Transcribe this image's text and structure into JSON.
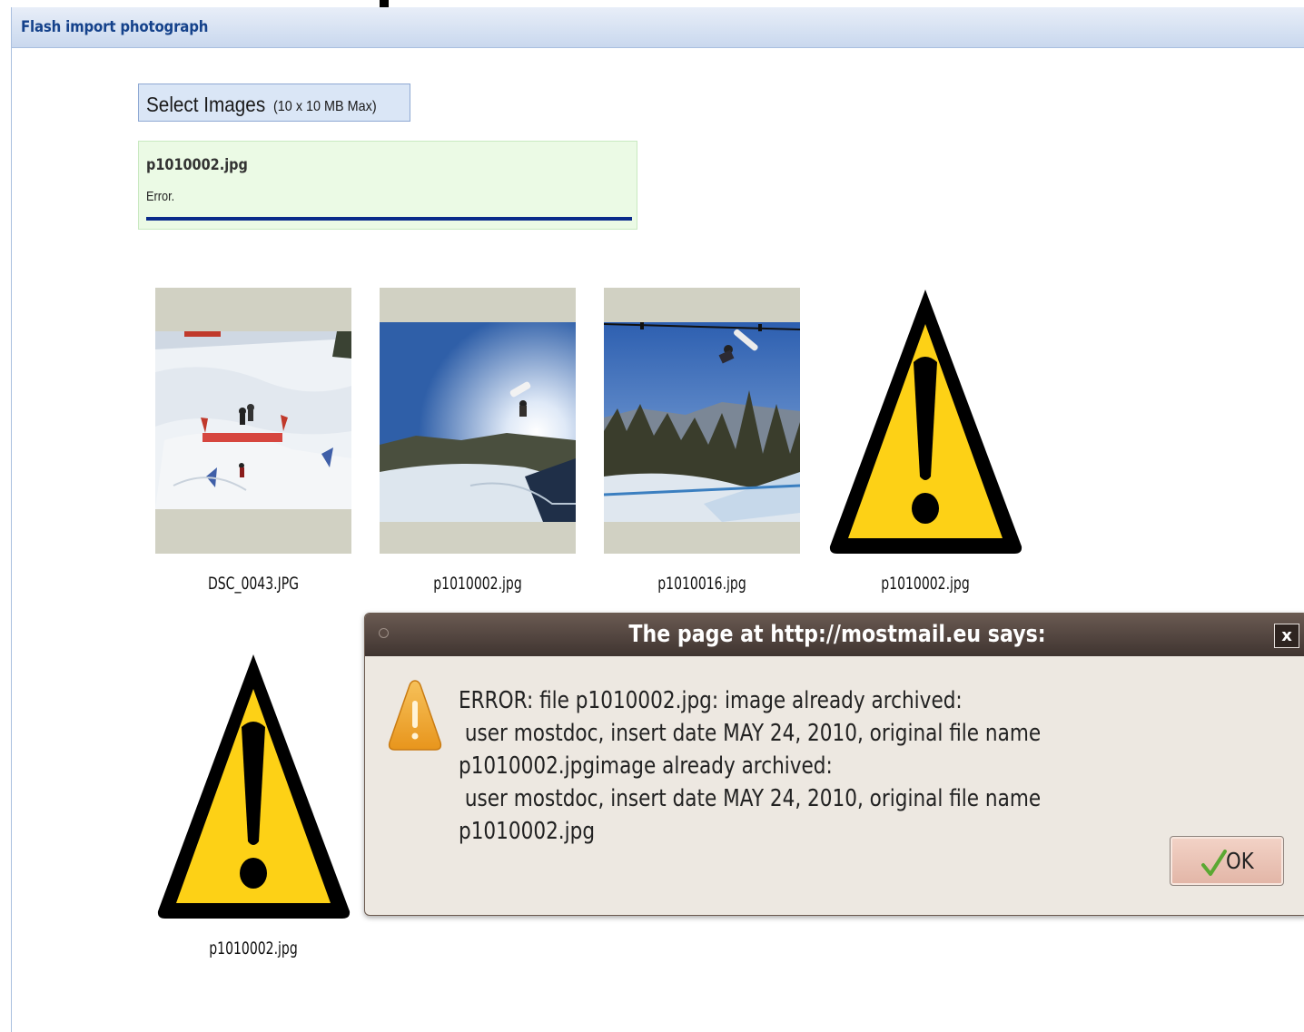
{
  "header": {
    "title": "Flash import photograph"
  },
  "uploader": {
    "select_label": "Select Images",
    "select_limit": "(10 x 10 MB Max)",
    "progress_file": "p1010002.jpg",
    "progress_status": "Error.",
    "progress_value": 1.0
  },
  "thumbnails": [
    {
      "name": "DSC_0043.JPG",
      "kind": "photo"
    },
    {
      "name": "p1010002.jpg",
      "kind": "photo"
    },
    {
      "name": "p1010016.jpg",
      "kind": "photo"
    },
    {
      "name": "p1010002.jpg",
      "kind": "warning-icon"
    },
    {
      "name": "p1010002.jpg",
      "kind": "warning-icon"
    }
  ],
  "dialog": {
    "title": "The page at http://mostmail.eu says:",
    "close_label": "x",
    "message": "ERROR: file p1010002.jpg: image already archived:\n user mostdoc, insert date MAY 24, 2010, original file name p1010002.jpgimage already archived:\n user mostdoc, insert date MAY 24, 2010, original file name p1010002.jpg",
    "ok_label": "OK"
  },
  "colors": {
    "header_text": "#15428b",
    "progress_panel_bg": "#ebfae5",
    "progress_fill": "#0a2a8a",
    "dialog_titlebar": "#4a3c36",
    "warning_yellow": "#fdd116"
  }
}
